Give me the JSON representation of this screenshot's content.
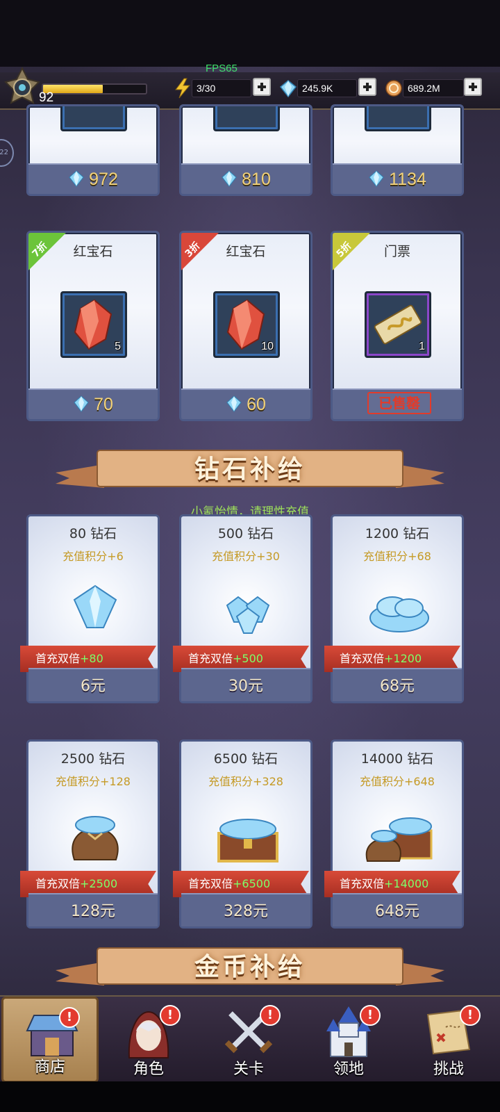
{
  "status": {
    "fps": "FPS65",
    "level": "92",
    "xp_fraction": 0.58
  },
  "resources": [
    {
      "icon": "lightning-icon",
      "value": "3/30"
    },
    {
      "icon": "diamond-icon",
      "value": "245.9K"
    },
    {
      "icon": "gold-coin-icon",
      "value": "689.2M"
    }
  ],
  "side_badge": "22",
  "top_row_prices": [
    "972",
    "810",
    "1134"
  ],
  "shop_items": [
    {
      "discount": "7折",
      "tag_color": "#6cc43a",
      "title": "红宝石",
      "icon": "ruby-icon",
      "count": "5",
      "price": "70"
    },
    {
      "discount": "3折",
      "tag_color": "#d9473a",
      "title": "红宝石",
      "icon": "ruby-icon",
      "count": "10",
      "price": "60"
    },
    {
      "discount": "5折",
      "tag_color": "#c8c83a",
      "title": "门票",
      "icon": "ticket-icon",
      "count": "1",
      "sold_out": "已售罄"
    }
  ],
  "diamond_section": {
    "title": "钻石补给",
    "notice": "小氪怡情，请理性充值"
  },
  "packs": [
    {
      "title": "80 钻石",
      "score": "充值积分+6",
      "promo": "首充双倍",
      "bonus": "+80",
      "price": "6元",
      "icon": "single-diamond-icon"
    },
    {
      "title": "500 钻石",
      "score": "充值积分+30",
      "promo": "首充双倍",
      "bonus": "+500",
      "price": "30元",
      "icon": "diamond-cluster-icon"
    },
    {
      "title": "1200 钻石",
      "score": "充值积分+68",
      "promo": "首充双倍",
      "bonus": "+1200",
      "price": "68元",
      "icon": "diamond-pile-icon"
    },
    {
      "title": "2500 钻石",
      "score": "充值积分+128",
      "promo": "首充双倍",
      "bonus": "+2500",
      "price": "128元",
      "icon": "diamond-bag-icon"
    },
    {
      "title": "6500 钻石",
      "score": "充值积分+328",
      "promo": "首充双倍",
      "bonus": "+6500",
      "price": "328元",
      "icon": "diamond-chest-icon"
    },
    {
      "title": "14000 钻石",
      "score": "充值积分+648",
      "promo": "首充双倍",
      "bonus": "+14000",
      "price": "648元",
      "icon": "diamond-treasure-icon"
    }
  ],
  "gold_section": {
    "title": "金币补给"
  },
  "nav": [
    {
      "label": "商店",
      "icon": "shop-icon",
      "active": true,
      "alert": "!"
    },
    {
      "label": "角色",
      "icon": "character-icon",
      "active": false,
      "alert": "!"
    },
    {
      "label": "关卡",
      "icon": "crossed-swords-icon",
      "active": false,
      "alert": "!"
    },
    {
      "label": "领地",
      "icon": "castle-icon",
      "active": false,
      "alert": "!"
    },
    {
      "label": "挑战",
      "icon": "scroll-map-icon",
      "active": false,
      "alert": "!"
    }
  ]
}
